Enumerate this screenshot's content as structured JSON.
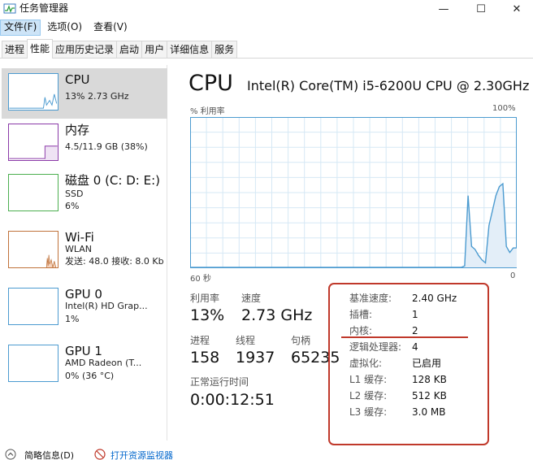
{
  "window": {
    "title": "任务管理器",
    "minimize_glyph": "—",
    "maximize_glyph": "☐",
    "close_glyph": "✕"
  },
  "menu": {
    "file": "文件(F)",
    "options": "选项(O)",
    "view": "查看(V)"
  },
  "tabs": [
    "进程",
    "性能",
    "应用历史记录",
    "启动",
    "用户",
    "详细信息",
    "服务"
  ],
  "sidebar": {
    "cpu": {
      "name": "CPU",
      "sub1": "13% 2.73 GHz"
    },
    "memory": {
      "name": "内存",
      "sub1": "4.5/11.9 GB (38%)"
    },
    "disk": {
      "name": "磁盘 0 (C: D: E:)",
      "sub1": "SSD",
      "sub2": "6%"
    },
    "wifi": {
      "name": "Wi-Fi",
      "sub1": "WLAN",
      "sub2": "发送: 48.0  接收: 8.0 Kb"
    },
    "gpu0": {
      "name": "GPU 0",
      "sub1": "Intel(R) HD Grap...",
      "sub2": "1%"
    },
    "gpu1": {
      "name": "GPU 1",
      "sub1": "AMD Radeon (T...",
      "sub2": "0% (36 °C)"
    }
  },
  "main": {
    "title": "CPU",
    "model": "Intel(R) Core(TM) i5-6200U CPU @ 2.30GHz",
    "graph_label_left": "% 利用率",
    "graph_label_right": "100%",
    "time_left": "60 秒",
    "time_right": "0"
  },
  "stats": {
    "utilization": {
      "label": "利用率",
      "value": "13%"
    },
    "speed": {
      "label": "速度",
      "value": "2.73 GHz"
    },
    "processes": {
      "label": "进程",
      "value": "158"
    },
    "threads": {
      "label": "线程",
      "value": "1937"
    },
    "handles": {
      "label": "句柄",
      "value": "65235"
    },
    "uptime": {
      "label": "正常运行时间",
      "value": "0:00:12:51"
    }
  },
  "specs": [
    {
      "label": "基准速度:",
      "value": "2.40 GHz"
    },
    {
      "label": "插槽:",
      "value": "1"
    },
    {
      "label": "内核:",
      "value": "2"
    },
    {
      "label": "逻辑处理器:",
      "value": "4"
    },
    {
      "label": "虚拟化:",
      "value": "已启用"
    },
    {
      "label": "L1 缓存:",
      "value": "128 KB"
    },
    {
      "label": "L2 缓存:",
      "value": "512 KB"
    },
    {
      "label": "L3 缓存:",
      "value": "3.0 MB"
    }
  ],
  "cpu_history": [
    0,
    0,
    0,
    0,
    0,
    0,
    0,
    0,
    0,
    0,
    0,
    0,
    0,
    0,
    0,
    0,
    0,
    0,
    0,
    0,
    0,
    0,
    0,
    0,
    0,
    0,
    0,
    0,
    0,
    0,
    0,
    0,
    0,
    0,
    0,
    0,
    0,
    0,
    0,
    0,
    0,
    0,
    0,
    0,
    0,
    0,
    0,
    0,
    0,
    0,
    0,
    0,
    0,
    0,
    0,
    0,
    0,
    0,
    0,
    0,
    0,
    0,
    0,
    0,
    0,
    0,
    0,
    0,
    0,
    0,
    0,
    0,
    0,
    0,
    0,
    0,
    0,
    0,
    0,
    1,
    48,
    14,
    12,
    8,
    5,
    3,
    28,
    38,
    48,
    54,
    56,
    14,
    10,
    13,
    13
  ],
  "footer": {
    "brief": "简略信息(D)",
    "monitor": "打开资源监视器"
  },
  "colors": {
    "cpu_line": "#4c9bd0",
    "cpu_fill": "#e3eef8",
    "cpu_grid": "#d6e8f5",
    "memory": "#8b3aa8",
    "disk": "#4caf50",
    "wifi": "#c0723a",
    "gpu": "#4c9bd0",
    "annotation": "#c0392b"
  }
}
